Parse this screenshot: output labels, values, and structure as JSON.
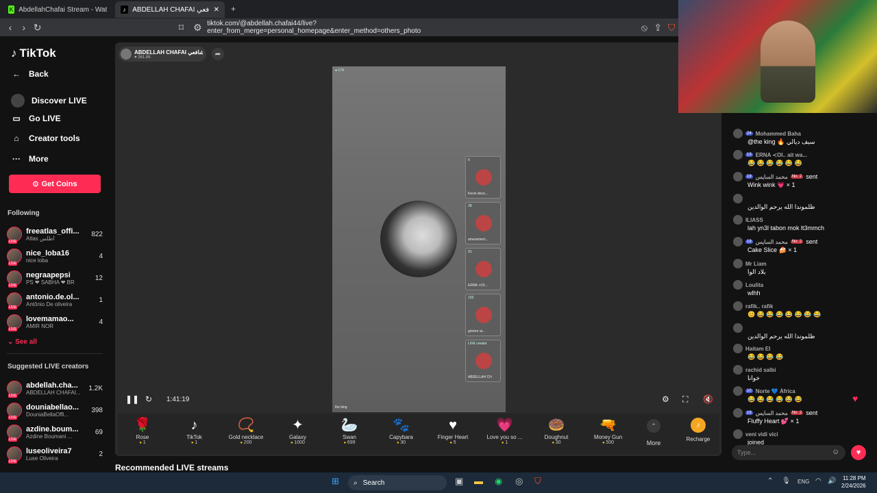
{
  "tabs": [
    {
      "title": "AbdellahChafai Stream - Watch Live..."
    },
    {
      "title": "ABDELLAH CHAFAI عبدالله شافعي ..."
    }
  ],
  "new_tab": "+",
  "url": "tiktok.com/@abdellah.chafai44/live?enter_from_merge=personal_homepage&enter_method=others_photo",
  "sidebar": {
    "logo": "TikTok",
    "back": "Back",
    "discover": "Discover LIVE",
    "go_live": "Go LIVE",
    "creator_tools": "Creator tools",
    "more": "More",
    "get_coins": "Get Coins",
    "following_header": "Following",
    "following": [
      {
        "name": "freeatlas_offi...",
        "sub": "Atlas أطلس",
        "count": "822"
      },
      {
        "name": "nice_loba16",
        "sub": "nice loba",
        "count": "4"
      },
      {
        "name": "negraapepsi",
        "sub": "PS ❤ SABHA ❤ BR",
        "count": "12"
      },
      {
        "name": "antonio.de.ol...",
        "sub": "Antônio De oliveira",
        "count": "1"
      },
      {
        "name": "lovemamao...",
        "sub": "AMIR NOR",
        "count": "4"
      }
    ],
    "see_all": "See all",
    "suggested_header": "Suggested LIVE creators",
    "suggested": [
      {
        "name": "abdellah.cha...",
        "sub": "ABDELLAH CHAFAI...",
        "count": "1.2K"
      },
      {
        "name": "douniabellao...",
        "sub": "DouniaBellaOffi...",
        "count": "398"
      },
      {
        "name": "azdine.boum...",
        "sub": "Azdine Boumani ...",
        "count": "69"
      },
      {
        "name": "luseoliveira7",
        "sub": "Luse Oliveira",
        "count": "2"
      }
    ]
  },
  "host": {
    "name": "ABDELLAH CHAFAI عبدالله شافعي",
    "likes": "361.8K"
  },
  "video": {
    "viewers": "174",
    "caption": "the king",
    "guests": [
      {
        "count": "6",
        "name": "Kevin dece..."
      },
      {
        "count": "28",
        "name": "amesemert..."
      },
      {
        "count": "91",
        "name": "ERNA ≺OI..."
      },
      {
        "count": "133",
        "name": "génère al..."
      },
      {
        "count": "LIVE creator",
        "name": "ABDELLAH CH"
      }
    ],
    "time": "1:41:19"
  },
  "gifts": [
    {
      "icon": "🌹",
      "name": "Rose",
      "price": "1"
    },
    {
      "icon": "♪",
      "name": "TikTok",
      "price": "1"
    },
    {
      "icon": "📿",
      "name": "Gold necklace",
      "price": "200"
    },
    {
      "icon": "✦",
      "name": "Galaxy",
      "price": "1000"
    },
    {
      "icon": "🦢",
      "name": "Swan",
      "price": "699"
    },
    {
      "icon": "🐾",
      "name": "Capybara",
      "price": "30"
    },
    {
      "icon": "♥",
      "name": "Finger Heart",
      "price": "5"
    },
    {
      "icon": "💗",
      "name": "Love you so ...",
      "price": "1"
    },
    {
      "icon": "🍩",
      "name": "Doughnut",
      "price": "30"
    },
    {
      "icon": "🔫",
      "name": "Money Gun",
      "price": "500"
    }
  ],
  "gift_more": "More",
  "recharge": "Recharge",
  "recommended": "Recommended LIVE streams",
  "chat": [
    {
      "name": "Mohammed Baha",
      "badge": "24",
      "text": "@the king 🔥 سيف ديالي"
    },
    {
      "name": "ERNA ≺OI..  ait wa...",
      "badge": "13",
      "text": "😂 😂 😂 😂 😂 😂"
    },
    {
      "name": "محمد السايس",
      "badge": "19",
      "rank": "No. 2",
      "sent": "sent",
      "text": "Wink wink 💗 × 1"
    },
    {
      "name": "",
      "badge": "",
      "text": "ظلموندا الله يرحم الوالدين"
    },
    {
      "name": "ILIASS",
      "badge": "",
      "text": "lah yn3l tabon mok lt3mmch"
    },
    {
      "name": "محمد السايس",
      "badge": "19",
      "rank": "No. 2",
      "sent": "sent",
      "text": "Cake Slice 🍰 × 1"
    },
    {
      "name": "Mr Liam",
      "badge": "",
      "text": "بلاد الوا"
    },
    {
      "name": "Loulita",
      "badge": "",
      "text": "wlhh"
    },
    {
      "name": "rafik.. rafik",
      "badge": "",
      "text": "😊 😂 😂 😂 😂 😂 😂 😂"
    },
    {
      "name": "",
      "badge": "",
      "text": "ظلموندا الله يرحم الوالدين"
    },
    {
      "name": "Haitam El",
      "badge": "",
      "text": "😂 😂 😂 😂"
    },
    {
      "name": "rachid salbi",
      "badge": "",
      "text": "خوانا"
    },
    {
      "name": "Norte 💙 África",
      "badge": "10",
      "text": "😂 😂 😂 😂 😂 😂"
    },
    {
      "name": "محمد السايس",
      "badge": "19",
      "rank": "No. 2",
      "sent": "sent",
      "text": "Fluffy Heart 💕 × 1"
    },
    {
      "name": "veni vidi vici",
      "badge": "",
      "text": "joined"
    }
  ],
  "chat_placeholder": "Type...",
  "taskbar": {
    "search": "Search",
    "lang": "ENG",
    "time": "11:28 PM",
    "date": "2/24/2026"
  }
}
